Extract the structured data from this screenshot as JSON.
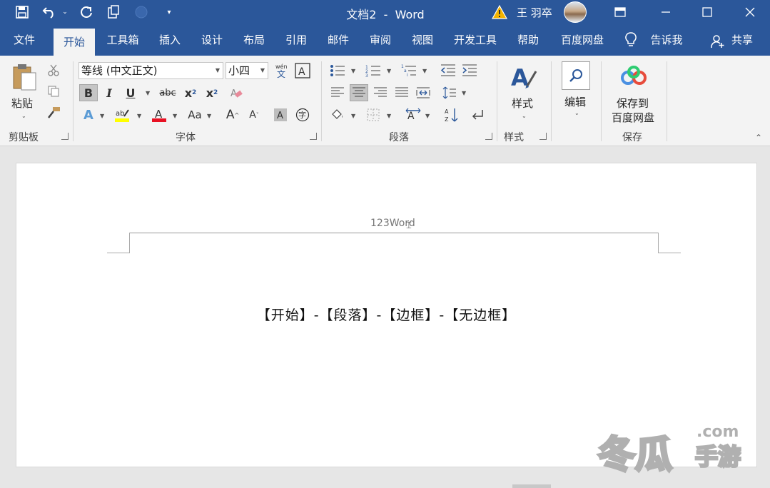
{
  "titlebar": {
    "title": "文档2  -  Word",
    "user_name": "王 羽卒",
    "colors": {
      "bar": "#2b579a",
      "warning": "#f4b400"
    }
  },
  "tabs": [
    {
      "label": "文件"
    },
    {
      "label": "开始"
    },
    {
      "label": "工具箱"
    },
    {
      "label": "插入"
    },
    {
      "label": "设计"
    },
    {
      "label": "布局"
    },
    {
      "label": "引用"
    },
    {
      "label": "邮件"
    },
    {
      "label": "审阅"
    },
    {
      "label": "视图"
    },
    {
      "label": "开发工具"
    },
    {
      "label": "帮助"
    },
    {
      "label": "百度网盘"
    }
  ],
  "tell_me": "告诉我",
  "share": "共享",
  "ribbon": {
    "clipboard": {
      "paste": "粘贴",
      "label": "剪贴板"
    },
    "font": {
      "name": "等线 (中文正文)",
      "size": "小四",
      "label": "字体"
    },
    "paragraph": {
      "label": "段落"
    },
    "styles": {
      "button": "样式",
      "label": "样式"
    },
    "editing": {
      "button": "编辑"
    },
    "save": {
      "line1": "保存到",
      "line2": "百度网盘",
      "label": "保存"
    }
  },
  "document": {
    "header_text": "123Word",
    "body_text": "【开始】-【段落】-【边框】-【无边框】"
  },
  "watermark": {
    "main": "冬瓜",
    "sub": "手游",
    "com": ".com"
  }
}
